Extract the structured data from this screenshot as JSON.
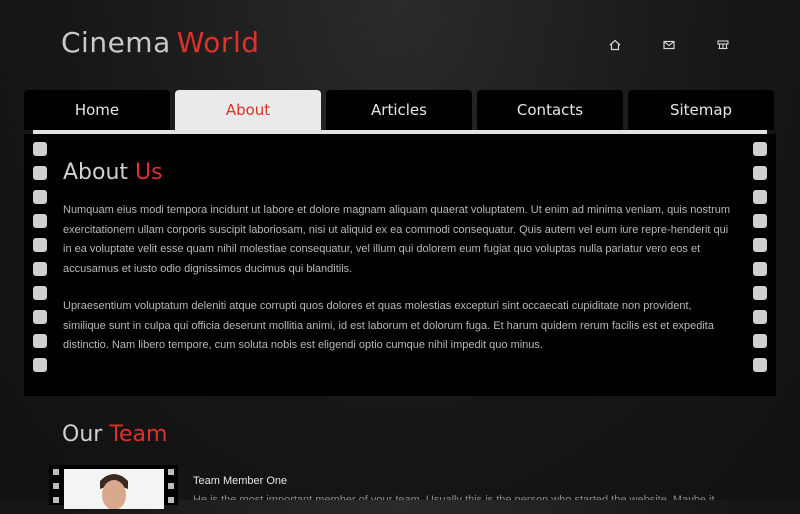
{
  "header": {
    "logo_part1": "Cinema",
    "logo_part2": "World",
    "icons": [
      "home-icon",
      "mail-icon",
      "sitemap-icon"
    ]
  },
  "nav": {
    "tabs": [
      "Home",
      "About",
      "Articles",
      "Contacts",
      "Sitemap"
    ],
    "active": "About"
  },
  "about": {
    "title_part1": "About",
    "title_part2": "Us",
    "paragraph1": "Numquam eius modi tempora incidunt ut labore et dolore magnam aliquam quaerat voluptatem. Ut enim ad minima veniam, quis nostrum exercitationem ullam corporis suscipit laboriosam, nisi ut aliquid ex ea commodi consequatur. Quis autem vel eum iure repre-henderit qui in ea voluptate velit esse quam nihil molestiae consequatur, vel illum qui dolorem eum fugiat quo voluptas nulla pariatur vero eos et accusamus et iusto odio dignissimos ducimus qui blanditiis.",
    "paragraph2": "Upraesentium voluptatum deleniti atque corrupti quos dolores et quas molestias excepturi sint occaecati cupiditate non provident, similique sunt in culpa qui officia deserunt mollitia animi, id est laborum et dolorum fuga. Et harum quidem rerum facilis est et expedita distinctio. Nam libero tempore, cum soluta nobis est eligendi optio cumque nihil impedit quo minus."
  },
  "team": {
    "title_part1": "Our",
    "title_part2": "Team",
    "members": [
      {
        "name": "Team Member One",
        "description": "He is the most important member of your team. Usually this is the person who started the website. Maybe it"
      }
    ]
  },
  "colors": {
    "accent": "#e0302b",
    "tab_active_bg": "#eaeaea",
    "panel_bg": "#000000"
  }
}
